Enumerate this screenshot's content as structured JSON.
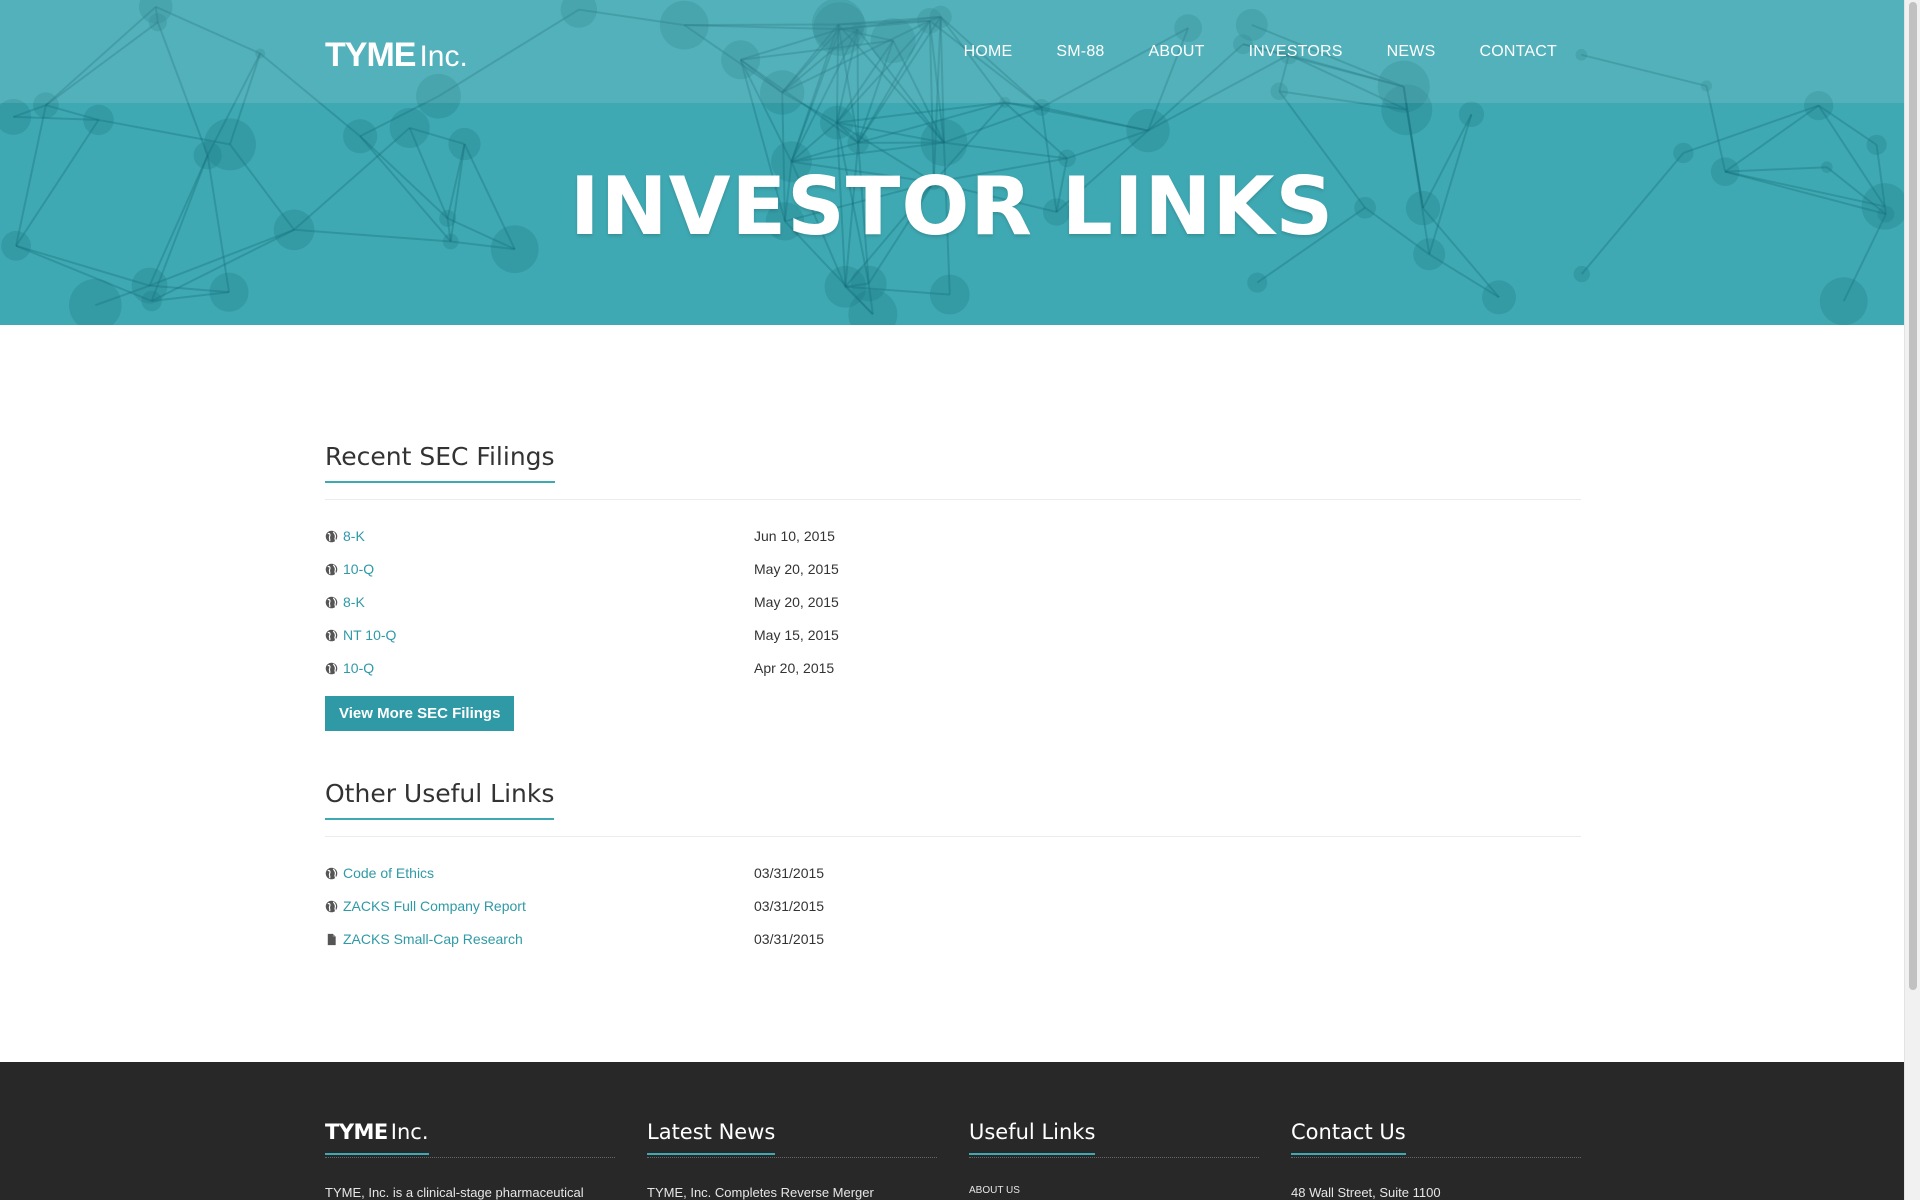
{
  "header": {
    "logo_main": "TYME",
    "logo_suffix": "Inc.",
    "nav": [
      "HOME",
      "SM-88",
      "ABOUT",
      "INVESTORS",
      "NEWS",
      "CONTACT"
    ]
  },
  "hero": {
    "title": "INVESTOR LINKS"
  },
  "sec_filings": {
    "heading": "Recent SEC Filings",
    "items": [
      {
        "label": "8-K",
        "date": "Jun 10, 2015",
        "icon": "globe-icon"
      },
      {
        "label": "10-Q",
        "date": "May 20, 2015",
        "icon": "globe-icon"
      },
      {
        "label": "8-K",
        "date": "May 20, 2015",
        "icon": "globe-icon"
      },
      {
        "label": "NT 10-Q",
        "date": "May 15, 2015",
        "icon": "globe-icon"
      },
      {
        "label": "10-Q",
        "date": "Apr 20, 2015",
        "icon": "globe-icon"
      }
    ],
    "button_label": "View More SEC Filings"
  },
  "other_links": {
    "heading": "Other Useful Links",
    "items": [
      {
        "label": "Code of Ethics",
        "date": "03/31/2015",
        "icon": "globe-icon"
      },
      {
        "label": "ZACKS Full Company Report",
        "date": "03/31/2015",
        "icon": "globe-icon"
      },
      {
        "label": "ZACKS Small-Cap Research",
        "date": "03/31/2015",
        "icon": "document-icon"
      }
    ]
  },
  "footer": {
    "logo_main": "TYME",
    "logo_suffix": "Inc.",
    "about_text": "TYME, Inc. is a clinical-stage pharmaceutical",
    "news_heading": "Latest News",
    "news_text": "TYME, Inc. Completes Reverse Merger",
    "links_heading": "Useful Links",
    "links_text": "ABOUT US",
    "contact_heading": "Contact Us",
    "contact_text": "48 Wall Street, Suite 1100"
  },
  "colors": {
    "accent": "#3fa9b3",
    "link": "#2f9aa6",
    "footer_bg": "#282828"
  }
}
